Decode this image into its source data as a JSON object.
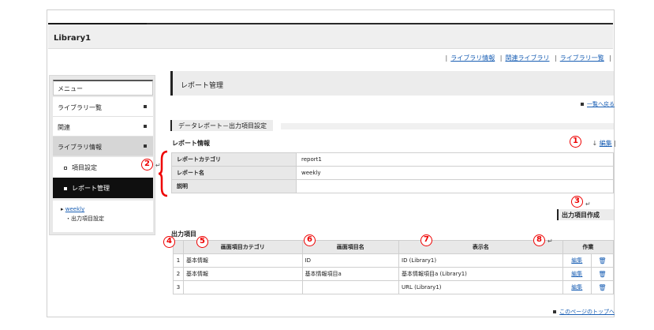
{
  "app": {
    "title": "Library1"
  },
  "toplinks": [
    "ライブラリ情報",
    "関連ライブラリ",
    "ライブラリ一覧"
  ],
  "sidebar": {
    "menu_title": "メニュー",
    "items": [
      {
        "label": "ライブラリ一覧"
      },
      {
        "label": "関連"
      },
      {
        "label": "ライブラリ情報"
      }
    ],
    "sub_items": [
      {
        "label": "項目設定"
      },
      {
        "label": "レポート管理"
      }
    ],
    "tail_link": "weekly",
    "tail_sub": "・出力項目設定"
  },
  "main": {
    "page_title": "レポート管理",
    "back_link": "一覧へ戻る",
    "section_title": "データレポート－出力項目設定",
    "info_label": "レポート情報",
    "edit_link": "編集",
    "info_rows": [
      {
        "label": "レポートカテゴリ",
        "value": "report1"
      },
      {
        "label": "レポート名",
        "value": "weekly"
      },
      {
        "label": "説明",
        "value": ""
      }
    ],
    "create_button": "出力項目作成",
    "output_label": "出力項目",
    "columns": [
      "画面項目カテゴリ",
      "画面項目名",
      "表示名",
      "作業"
    ],
    "rows": [
      {
        "no": "1",
        "category": "基本情報",
        "item": "ID",
        "display": "ID (Library1)",
        "edit": "編集"
      },
      {
        "no": "2",
        "category": "基本情報",
        "item": "基本情報項目a",
        "display": "基本情報項目a (Library1)",
        "edit": "編集"
      },
      {
        "no": "3",
        "category": "",
        "item": "",
        "display": "URL (Library1)",
        "edit": "編集"
      }
    ],
    "page_top": "このページのトップへ"
  },
  "callouts": [
    "1",
    "2",
    "3",
    "4",
    "5",
    "6",
    "7",
    "8"
  ],
  "colors": {
    "link": "#1a5fb4",
    "callout": "#e00000",
    "active_bg": "#0f0f0f"
  }
}
